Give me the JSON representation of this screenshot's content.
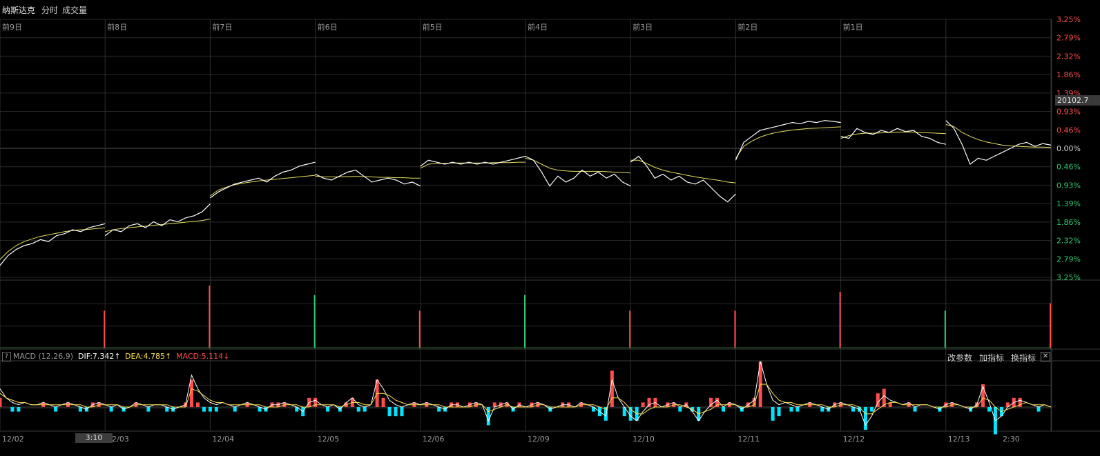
{
  "header": {
    "index_name": "纳斯达克",
    "tab_minute": "分时",
    "tab_volume": "成交量"
  },
  "price_tag": "20102.7",
  "macd": {
    "help": "?",
    "label": "MACD (12,26,9)",
    "dif": "DIF:7.342↑",
    "dea": "DEA:4.785↑",
    "macd": "MACD:5.114↓",
    "btn_params": "改参数",
    "btn_add": "加指标",
    "btn_switch": "换指标",
    "btn_close": "✕"
  },
  "cursor_time": "3:10",
  "colors": {
    "background": "#000000",
    "grid": "#2a2a2a",
    "price_line": "#ffffff",
    "avg_line": "#e8e060",
    "up": "#ff4d4d",
    "down": "#2ecc71",
    "macd_neg": "#00e5ff",
    "dea": "#ffe34d"
  },
  "chart_data": {
    "type": "line",
    "day_labels": [
      "前9日",
      "前8日",
      "前7日",
      "前6日",
      "前5日",
      "前4日",
      "前3日",
      "前2日",
      "前1日"
    ],
    "date_labels": [
      "12/02",
      "12/03",
      "12/04",
      "12/05",
      "12/06",
      "12/09",
      "12/10",
      "12/11",
      "12/12",
      "12/13",
      "2:30"
    ],
    "y_labels": [
      "3.25%",
      "2.79%",
      "2.32%",
      "1.86%",
      "1.39%",
      "0.93%",
      "0.46%",
      "0.00%",
      "0.46%",
      "0.93%",
      "1.39%",
      "1.86%",
      "2.32%",
      "2.79%",
      "3.25%"
    ],
    "ylim": [
      -3.25,
      3.25
    ],
    "days": [
      {
        "points": [
          -2.95,
          -2.7,
          -2.55,
          -2.45,
          -2.4,
          -2.3,
          -2.35,
          -2.2,
          -2.15,
          -2.05,
          -2.1,
          -2.0,
          -1.95,
          -1.9
        ],
        "avg": [
          -2.8,
          -2.6,
          -2.45,
          -2.35,
          -2.28,
          -2.22,
          -2.18,
          -2.14,
          -2.1,
          -2.07,
          -2.05,
          -2.04,
          -2.02,
          -2.0
        ]
      },
      {
        "points": [
          -2.2,
          -2.05,
          -2.1,
          -1.95,
          -1.9,
          -2.0,
          -1.85,
          -1.95,
          -1.8,
          -1.85,
          -1.75,
          -1.7,
          -1.6,
          -1.4
        ],
        "avg": [
          -2.1,
          -2.05,
          -2.02,
          -2.0,
          -1.98,
          -1.96,
          -1.94,
          -1.92,
          -1.9,
          -1.88,
          -1.86,
          -1.84,
          -1.82,
          -1.78
        ]
      },
      {
        "points": [
          -1.25,
          -1.1,
          -1.0,
          -0.9,
          -0.85,
          -0.8,
          -0.75,
          -0.85,
          -0.7,
          -0.6,
          -0.55,
          -0.45,
          -0.4,
          -0.35
        ],
        "avg": [
          -1.2,
          -1.05,
          -0.98,
          -0.92,
          -0.88,
          -0.85,
          -0.82,
          -0.8,
          -0.78,
          -0.76,
          -0.74,
          -0.72,
          -0.7,
          -0.68
        ]
      },
      {
        "points": [
          -0.65,
          -0.75,
          -0.8,
          -0.7,
          -0.6,
          -0.55,
          -0.7,
          -0.85,
          -0.8,
          -0.75,
          -0.8,
          -0.9,
          -0.85,
          -0.95
        ],
        "avg": [
          -0.7,
          -0.72,
          -0.72,
          -0.72,
          -0.71,
          -0.71,
          -0.71,
          -0.72,
          -0.73,
          -0.73,
          -0.74,
          -0.74,
          -0.75,
          -0.75
        ]
      },
      {
        "points": [
          -0.45,
          -0.3,
          -0.35,
          -0.4,
          -0.35,
          -0.4,
          -0.35,
          -0.4,
          -0.35,
          -0.4,
          -0.35,
          -0.3,
          -0.25,
          -0.2
        ],
        "avg": [
          -0.5,
          -0.4,
          -0.38,
          -0.38,
          -0.37,
          -0.37,
          -0.37,
          -0.37,
          -0.37,
          -0.36,
          -0.36,
          -0.36,
          -0.35,
          -0.35
        ]
      },
      {
        "points": [
          -0.2,
          -0.3,
          -0.6,
          -0.95,
          -0.7,
          -0.85,
          -0.75,
          -0.55,
          -0.7,
          -0.6,
          -0.75,
          -0.65,
          -0.85,
          -0.95
        ],
        "avg": [
          -0.25,
          -0.3,
          -0.4,
          -0.5,
          -0.55,
          -0.57,
          -0.58,
          -0.58,
          -0.58,
          -0.58,
          -0.59,
          -0.6,
          -0.61,
          -0.62
        ]
      },
      {
        "points": [
          -0.35,
          -0.2,
          -0.45,
          -0.75,
          -0.65,
          -0.8,
          -0.7,
          -0.85,
          -0.9,
          -0.8,
          -1.0,
          -1.2,
          -1.35,
          -1.15
        ],
        "avg": [
          -0.3,
          -0.3,
          -0.38,
          -0.48,
          -0.55,
          -0.6,
          -0.64,
          -0.68,
          -0.72,
          -0.75,
          -0.78,
          -0.81,
          -0.85,
          -0.87
        ]
      },
      {
        "points": [
          -0.3,
          0.15,
          0.3,
          0.45,
          0.5,
          0.55,
          0.6,
          0.65,
          0.62,
          0.68,
          0.65,
          0.7,
          0.68,
          0.65
        ],
        "avg": [
          -0.25,
          0.05,
          0.18,
          0.28,
          0.35,
          0.4,
          0.43,
          0.46,
          0.48,
          0.5,
          0.51,
          0.52,
          0.53,
          0.54
        ]
      },
      {
        "points": [
          0.3,
          0.25,
          0.5,
          0.4,
          0.35,
          0.45,
          0.4,
          0.5,
          0.42,
          0.45,
          0.3,
          0.25,
          0.15,
          0.1
        ],
        "avg": [
          0.25,
          0.32,
          0.36,
          0.38,
          0.38,
          0.39,
          0.4,
          0.41,
          0.41,
          0.41,
          0.4,
          0.39,
          0.38,
          0.37
        ]
      },
      {
        "points": [
          0.7,
          0.5,
          0.1,
          -0.4,
          -0.25,
          -0.3,
          -0.2,
          -0.1,
          0.0,
          0.1,
          0.15,
          0.05,
          0.12,
          0.08
        ],
        "avg": [
          0.6,
          0.55,
          0.4,
          0.3,
          0.22,
          0.16,
          0.12,
          0.08,
          0.06,
          0.05,
          0.04,
          0.03,
          0.03,
          0.02
        ]
      }
    ],
    "volume_spikes": [
      {
        "day": 1,
        "level": 0.6,
        "color": "up"
      },
      {
        "day": 2,
        "level": 1.0,
        "color": "up"
      },
      {
        "day": 3,
        "level": 0.85,
        "color": "down"
      },
      {
        "day": 4,
        "level": 0.6,
        "color": "up"
      },
      {
        "day": 5,
        "level": 0.85,
        "color": "down"
      },
      {
        "day": 6,
        "level": 0.6,
        "color": "up"
      },
      {
        "day": 7,
        "level": 0.6,
        "color": "up"
      },
      {
        "day": 8,
        "level": 0.9,
        "color": "up"
      },
      {
        "day": 9,
        "level": 0.6,
        "color": "down"
      },
      {
        "day": 10,
        "level": 0.72,
        "color": "up"
      }
    ],
    "macd_dif": [
      8,
      4,
      2,
      1,
      2,
      1,
      1,
      2,
      1,
      0,
      1,
      2,
      1,
      0,
      -1,
      1,
      2,
      1,
      0,
      1,
      -1,
      0,
      2,
      1,
      0,
      1,
      1,
      0,
      -1,
      0,
      1,
      14,
      8,
      4,
      2,
      1,
      2,
      1,
      0,
      1,
      2,
      1,
      0,
      -1,
      1,
      1,
      2,
      1,
      0,
      -2,
      2,
      3,
      1,
      0,
      1,
      -1,
      2,
      4,
      1,
      0,
      1,
      12,
      8,
      3,
      1,
      0,
      1,
      2,
      1,
      2,
      1,
      0,
      -1,
      1,
      1,
      0,
      1,
      2,
      1,
      -6,
      0,
      1,
      2,
      -1,
      1,
      0,
      1,
      2,
      1,
      -1,
      0,
      1,
      1,
      0,
      2,
      1,
      0,
      -2,
      -4,
      12,
      4,
      0,
      -4,
      -6,
      -2,
      1,
      2,
      0,
      1,
      2,
      0,
      1,
      -2,
      -6,
      -2,
      1,
      3,
      0,
      2,
      1,
      -1,
      1,
      3,
      20,
      10,
      3,
      1,
      2,
      1,
      0,
      1,
      2,
      1,
      0,
      -1,
      1,
      2,
      1,
      0,
      -1,
      -8,
      -4,
      2,
      5,
      3,
      2,
      1,
      2,
      0,
      1,
      1,
      0,
      -1,
      1,
      2,
      1,
      0,
      -1,
      1,
      9,
      2,
      -6,
      -4,
      0,
      2,
      3,
      2,
      1,
      0,
      1,
      0
    ],
    "macd_dea": [
      6,
      4,
      3,
      2,
      2,
      1,
      1,
      1,
      1,
      1,
      1,
      1,
      1,
      1,
      0,
      0,
      1,
      1,
      1,
      1,
      0,
      0,
      1,
      1,
      1,
      1,
      1,
      1,
      0,
      0,
      0,
      8,
      7,
      5,
      3,
      2,
      2,
      1,
      1,
      1,
      1,
      1,
      1,
      0,
      0,
      0,
      1,
      1,
      1,
      0,
      0,
      1,
      1,
      1,
      1,
      0,
      1,
      2,
      2,
      1,
      1,
      6,
      6,
      5,
      3,
      2,
      1,
      1,
      1,
      1,
      1,
      1,
      0,
      0,
      0,
      0,
      0,
      1,
      1,
      -2,
      -1,
      0,
      1,
      0,
      0,
      0,
      0,
      1,
      1,
      0,
      0,
      0,
      0,
      0,
      1,
      1,
      1,
      0,
      -1,
      4,
      4,
      2,
      -1,
      -3,
      -3,
      -1,
      0,
      0,
      0,
      1,
      1,
      0,
      -1,
      -3,
      -2,
      -1,
      1,
      1,
      1,
      1,
      0,
      0,
      1,
      10,
      10,
      6,
      3,
      2,
      2,
      1,
      1,
      1,
      1,
      1,
      0,
      0,
      1,
      1,
      1,
      0,
      -3,
      -3,
      -1,
      1,
      2,
      2,
      1,
      1,
      1,
      1,
      1,
      0,
      0,
      0,
      1,
      1,
      0,
      0,
      0,
      4,
      3,
      0,
      -2,
      -1,
      0,
      1,
      2,
      1,
      1,
      1,
      0
    ],
    "x_segments": 10
  }
}
